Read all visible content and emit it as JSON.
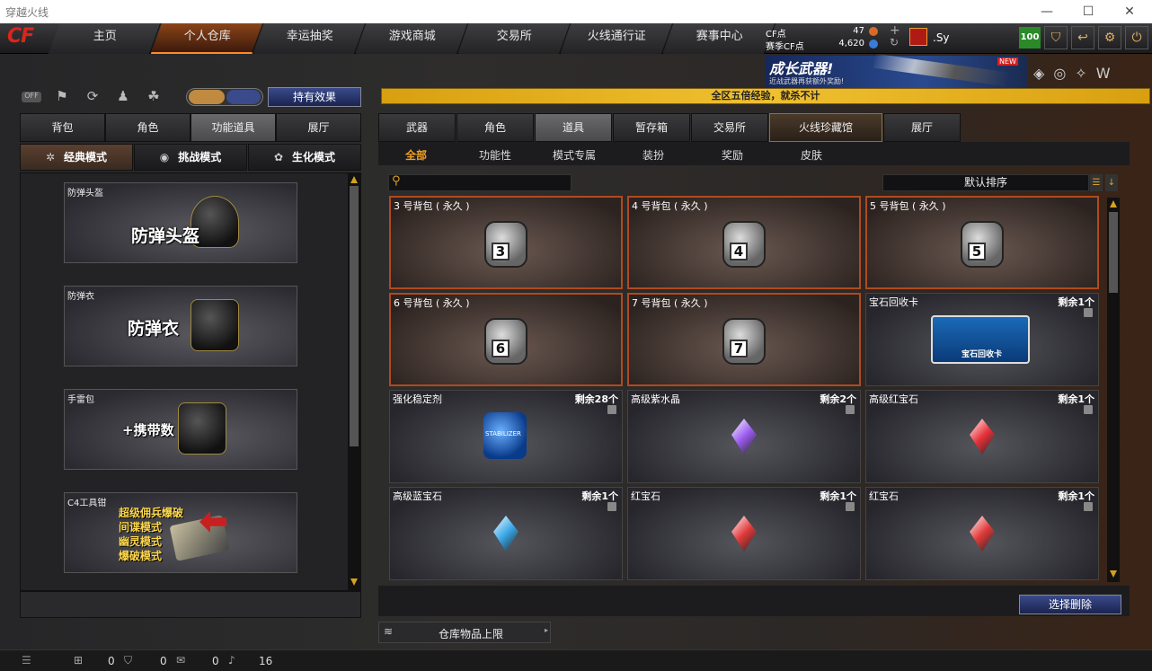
{
  "window": {
    "title": "穿越火线",
    "controls": [
      "—",
      "☐",
      "✕"
    ]
  },
  "nav": {
    "logo": "CF",
    "tabs": [
      "主页",
      "个人仓库",
      "幸运抽奖",
      "游戏商城",
      "交易所",
      "火线通行证",
      "赛事中心"
    ],
    "active_index": 1
  },
  "currency": {
    "cf_label": "CF点",
    "cf_value": "47",
    "season_label": "赛季CF点",
    "season_value": "4,620",
    "plus": "+",
    "refresh": "↻",
    "user": ".Sy",
    "level": "100"
  },
  "banner": {
    "title": "成长武器!",
    "sub": "近战武器再获额外奖励!",
    "badge": "NEW"
  },
  "left": {
    "quick_icons": [
      "OFF",
      "⚑",
      "⟳",
      "♟",
      "☘"
    ],
    "effect_button": "持有效果",
    "tabs": [
      "背包",
      "角色",
      "功能道具",
      "展厅"
    ],
    "tabs_selected": 2,
    "modes": [
      "经典模式",
      "挑战模式",
      "生化模式"
    ],
    "modes_selected": 0,
    "cards": [
      {
        "label": "防弹头盔",
        "big": "防弹头盔"
      },
      {
        "label": "防弹衣",
        "big": "防弹衣"
      },
      {
        "label": "手雷包",
        "big": "+携带数"
      },
      {
        "label": "C4工具钳",
        "lines": [
          "超级佣兵爆破",
          "间谍模式",
          "幽灵模式",
          "爆破模式"
        ]
      }
    ]
  },
  "notice": "全区五倍经验，就杀不计",
  "right": {
    "tabs": [
      "武器",
      "角色",
      "道具",
      "暂存箱",
      "交易所",
      "火线珍藏馆",
      "展厅"
    ],
    "tabs_selected": 2,
    "subtabs": [
      "全部",
      "功能性",
      "模式专属",
      "装扮",
      "奖励",
      "皮肤"
    ],
    "subtabs_selected": 0,
    "search_placeholder": "",
    "sort_label": "默认排序",
    "items": [
      {
        "name": "3 号背包 ( 永久 )",
        "type": "bag",
        "num": "3",
        "count": ""
      },
      {
        "name": "4 号背包 ( 永久 )",
        "type": "bag",
        "num": "4",
        "count": ""
      },
      {
        "name": "5 号背包 ( 永久 )",
        "type": "bag",
        "num": "5",
        "count": ""
      },
      {
        "name": "6 号背包 ( 永久 )",
        "type": "bag",
        "num": "6",
        "count": ""
      },
      {
        "name": "7 号背包 ( 永久 )",
        "type": "bag",
        "num": "7",
        "count": ""
      },
      {
        "name": "宝石回收卡",
        "type": "card",
        "count": "剩余1个",
        "card_text": "宝石回收卡"
      },
      {
        "name": "强化稳定剂",
        "type": "jar",
        "count": "剩余28个",
        "jar_text": "STABILIZER"
      },
      {
        "name": "高级紫水晶",
        "type": "gem",
        "color": "#9b5cf0",
        "count": "剩余2个"
      },
      {
        "name": "高级红宝石",
        "type": "gem",
        "color": "#e8323a",
        "count": "剩余1个"
      },
      {
        "name": "高级蓝宝石",
        "type": "gem",
        "color": "#3aa8e8",
        "count": "剩余1个"
      },
      {
        "name": "红宝石",
        "type": "gem",
        "color": "#e23a3a",
        "count": "剩余1个"
      },
      {
        "name": "红宝石",
        "type": "gem",
        "color": "#e23a3a",
        "count": "剩余1个"
      }
    ],
    "delete_button": "选择删除",
    "capacity_label": "仓库物品上限"
  },
  "status": {
    "a": "0",
    "b": "0",
    "c": "0",
    "d": "16"
  }
}
